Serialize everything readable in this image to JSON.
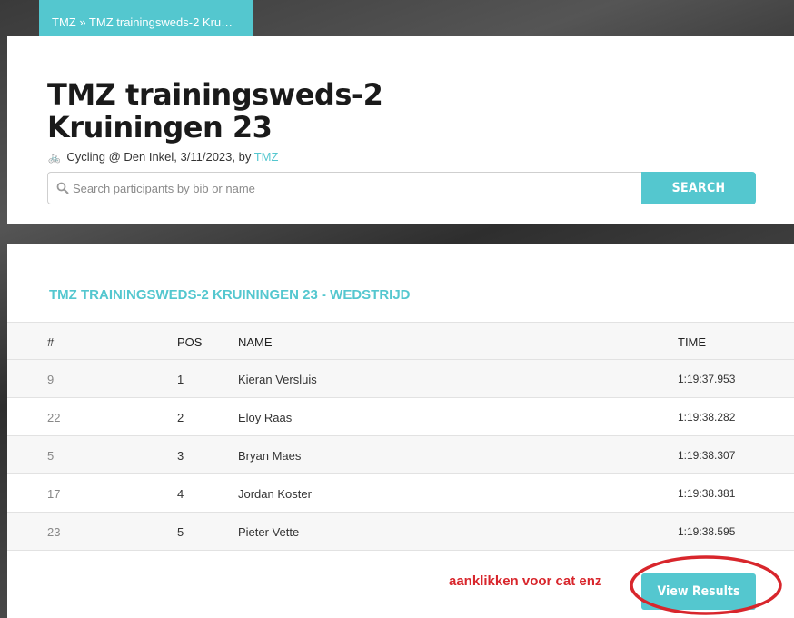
{
  "breadcrumb": "TMZ » TMZ trainingsweds-2 Kru…",
  "event": {
    "title_line1": "TMZ trainingsweds-2",
    "title_line2": "Kruiningen 23",
    "meta_prefix": "Cycling @ Den Inkel, 3/11/2023, by",
    "organizer_link": "TMZ"
  },
  "search": {
    "placeholder": "Search participants by bib or name",
    "button_label": "SEARCH"
  },
  "results": {
    "race_title": "TMZ TRAININGSWEDS-2 KRUININGEN 23 - WEDSTRIJD",
    "columns": {
      "bib": "#",
      "pos": "POS",
      "name": "NAME",
      "time": "TIME"
    },
    "rows": [
      {
        "bib": "9",
        "pos": "1",
        "name": "Kieran Versluis",
        "time": "1:19:37.953"
      },
      {
        "bib": "22",
        "pos": "2",
        "name": "Eloy Raas",
        "time": "1:19:38.282"
      },
      {
        "bib": "5",
        "pos": "3",
        "name": "Bryan Maes",
        "time": "1:19:38.307"
      },
      {
        "bib": "17",
        "pos": "4",
        "name": "Jordan Koster",
        "time": "1:19:38.381"
      },
      {
        "bib": "23",
        "pos": "5",
        "name": "Pieter Vette",
        "time": "1:19:38.595"
      }
    ],
    "view_results_label": "View Results"
  },
  "annotation": {
    "text": "aanklikken voor cat enz",
    "color": "#d8262c"
  },
  "colors": {
    "accent": "#54c7cf",
    "annotation_red": "#d8262c"
  },
  "icons": {
    "search": "search-icon",
    "bike": "bicycle-icon"
  }
}
